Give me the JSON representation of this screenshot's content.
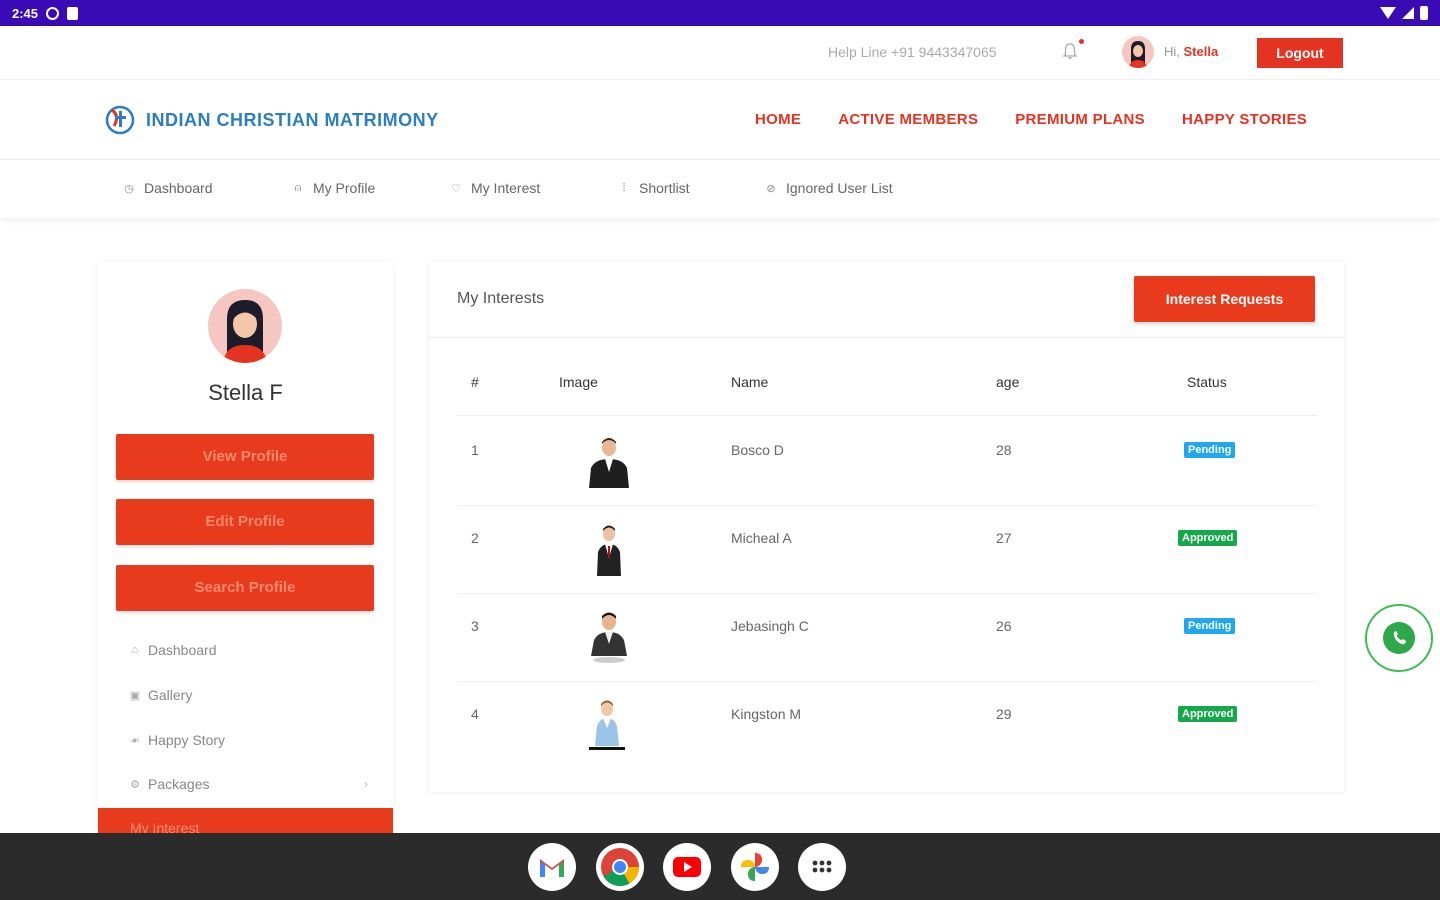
{
  "statusbar": {
    "time": "2:45"
  },
  "topbar": {
    "helpline": "Help Line +91 9443347065",
    "greeting_prefix": "Hi,",
    "user_name": "Stella",
    "logout_label": "Logout"
  },
  "brand": {
    "name": "INDIAN CHRISTIAN MATRIMONY",
    "accent": "#e53322",
    "blue": "#2b7ec2"
  },
  "mainnav": [
    {
      "label": "HOME"
    },
    {
      "label": "ACTIVE MEMBERS"
    },
    {
      "label": "PREMIUM PLANS"
    },
    {
      "label": "HAPPY STORIES"
    }
  ],
  "subnav": [
    {
      "label": "Dashboard",
      "icon": "clock-icon"
    },
    {
      "label": "My Profile",
      "icon": "user-icon"
    },
    {
      "label": "My Interest",
      "icon": "heart-icon"
    },
    {
      "label": "Shortlist",
      "icon": "list-icon"
    },
    {
      "label": "Ignored User List",
      "icon": "block-icon"
    }
  ],
  "sidebar": {
    "name": "Stella F",
    "buttons": {
      "view": "View Profile",
      "edit": "Edit Profile",
      "search": "Search Profile"
    },
    "links": [
      {
        "label": "Dashboard",
        "icon": "home-icon"
      },
      {
        "label": "Gallery",
        "icon": "image-icon"
      },
      {
        "label": "Happy Story",
        "icon": "heart-hand-icon"
      },
      {
        "label": "Packages",
        "icon": "package-icon"
      }
    ],
    "active_label": "My Interest"
  },
  "main": {
    "title": "My Interests",
    "requests_button": "Interest Requests",
    "columns": {
      "idx": "#",
      "image": "Image",
      "name": "Name",
      "age": "age",
      "status": "Status"
    },
    "rows": [
      {
        "idx": "1",
        "name": "Bosco D",
        "age": "28",
        "status": "Pending"
      },
      {
        "idx": "2",
        "name": "Micheal A",
        "age": "27",
        "status": "Approved"
      },
      {
        "idx": "3",
        "name": "Jebasingh C",
        "age": "26",
        "status": "Pending"
      },
      {
        "idx": "4",
        "name": "Kingston M",
        "age": "29",
        "status": "Approved"
      }
    ]
  },
  "dock": [
    "gmail-icon",
    "chrome-icon",
    "youtube-icon",
    "photos-icon",
    "app-drawer-icon"
  ]
}
